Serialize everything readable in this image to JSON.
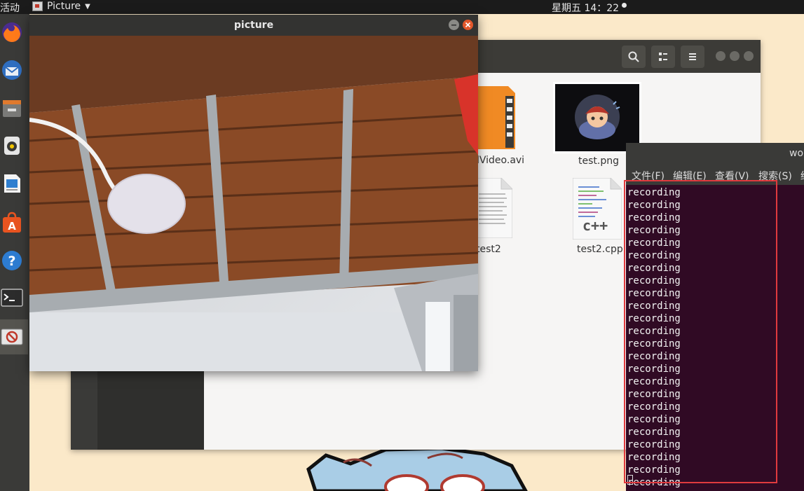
{
  "topbar": {
    "activities": "活动",
    "app_name": "Picture",
    "clock": "星期五 14：22"
  },
  "dock": {
    "items": [
      "firefox-icon",
      "thunderbird-icon",
      "files-icon",
      "rhythmbox-icon",
      "libreoffice-writer-icon",
      "software-center-icon",
      "help-icon",
      "terminal-icon",
      "picture-app-icon"
    ]
  },
  "file_manager": {
    "files": [
      {
        "name": "dVideo.avi",
        "icon": "video-file-icon"
      },
      {
        "name": "test.png",
        "icon": "image-thumbnail"
      },
      {
        "name": "test2",
        "icon": "text-file-icon"
      },
      {
        "name": "test2.cpp",
        "icon": "cpp-file-icon",
        "badge": "c++"
      }
    ]
  },
  "picture_window": {
    "title": "picture"
  },
  "terminal": {
    "title": "wo",
    "menu": [
      "文件(F)",
      "编辑(E)",
      "查看(V)",
      "搜索(S)",
      "终"
    ],
    "lines": [
      "recording",
      "recording",
      "recording",
      "recording",
      "recording",
      "recording",
      "recording",
      "recording",
      "recording",
      "recording",
      "recording",
      "recording",
      "recording",
      "recording",
      "recording",
      "recording",
      "recording",
      "recording",
      "recording",
      "recording",
      "recording",
      "recording",
      "recording",
      "recording"
    ]
  },
  "colors": {
    "highlight_box": "#e03a3e",
    "terminal_bg": "#300a24",
    "close_button": "#e2572b"
  }
}
